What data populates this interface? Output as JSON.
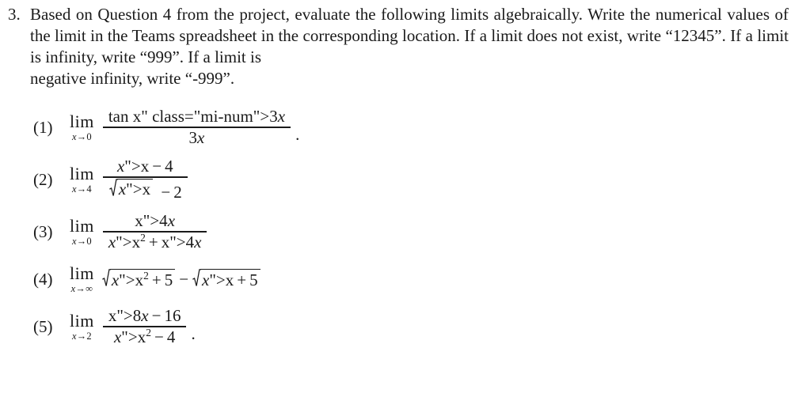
{
  "document": {
    "type": "math-worksheet-problem",
    "background_color": "#ffffff",
    "text_color": "#1a1a1a"
  },
  "problem": {
    "number": "3.",
    "stem_line1": "Based on Question 4 from the project, evaluate the following limits algebraically. Write",
    "stem_line2": "the numerical values of the limit in the Teams spreadsheet in the corresponding location.",
    "stem_line3": "If a limit does not exist, write “12345”. If a limit is infinity, write “999”. If a limit is",
    "stem_line4": "negative infinity, write “-999”.",
    "stem_full": "Based on Question 4 from the project, evaluate the following limits algebraically. Write the numerical values of the limit in the Teams spreadsheet in the corresponding location. If a limit does not exist, write “12345”. If a limit is infinity, write “999”. If a limit is negative infinity, write “-999”.",
    "special_values": {
      "does_not_exist": "12345",
      "infinity": "999",
      "negative_infinity": "-999"
    }
  },
  "limits": [
    {
      "label": "(1)",
      "operator": "lim",
      "subscript_var": "x",
      "subscript_arrow": "→",
      "subscript_target": "0",
      "subscript": "x→0",
      "numerator": "tan 3x",
      "denominator": "3x",
      "latex": "\\lim_{x\\to 0}\\frac{\\tan 3x}{3x}.",
      "trailing_punctuation": "."
    },
    {
      "label": "(2)",
      "operator": "lim",
      "subscript_var": "x",
      "subscript_arrow": "→",
      "subscript_target": "4",
      "subscript": "x→4",
      "numerator": "x − 4",
      "denominator": "√x − 2",
      "latex": "\\lim_{x\\to 4}\\frac{x-4}{\\sqrt{x}-2}",
      "trailing_punctuation": ""
    },
    {
      "label": "(3)",
      "operator": "lim",
      "subscript_var": "x",
      "subscript_arrow": "→",
      "subscript_target": "0",
      "subscript": "x→0",
      "numerator": "4x",
      "denominator": "x² + 4x",
      "latex": "\\lim_{x\\to 0}\\frac{4x}{x^2+4x}",
      "trailing_punctuation": ""
    },
    {
      "label": "(4)",
      "operator": "lim",
      "subscript_var": "x",
      "subscript_arrow": "→",
      "subscript_target": "∞",
      "subscript": "x→∞",
      "expression": "√(x² + 5) − √(x + 5)",
      "latex": "\\lim_{x\\to\\infty}\\sqrt{x^2+5}-\\sqrt{x+5}",
      "trailing_punctuation": ""
    },
    {
      "label": "(5)",
      "operator": "lim",
      "subscript_var": "x",
      "subscript_arrow": "→",
      "subscript_target": "2",
      "subscript": "x→2",
      "numerator": "8x − 16",
      "denominator": "x² − 4",
      "latex": "\\lim_{x\\to 2}\\frac{8x-16}{x^2-4}.",
      "trailing_punctuation": "."
    }
  ],
  "symbols": {
    "minus": "−",
    "plus": "+",
    "arrow": "→",
    "infinity": "∞",
    "superscript_two": "2",
    "tan": "tan",
    "four": "4",
    "five": "5",
    "sixteen": "16",
    "three_x": "3x",
    "four_x": "4x",
    "eight_x": "8x",
    "x": "x",
    "two": "2"
  }
}
